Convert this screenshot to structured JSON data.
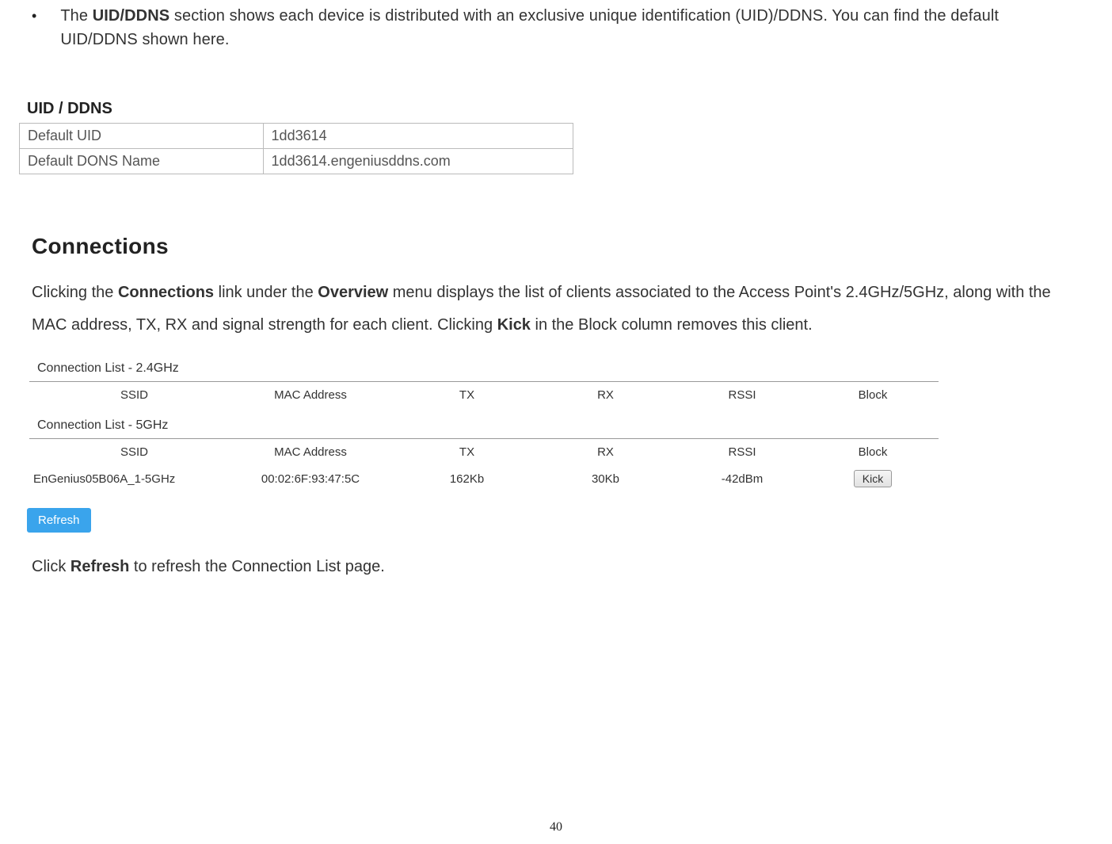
{
  "bullet": {
    "before": "The ",
    "bold": "UID/DDNS",
    "after": " section shows each device is distributed with an exclusive unique identification (UID)/DDNS. You can find the default UID/DDNS shown here."
  },
  "uid": {
    "title": "UID / DDNS",
    "rows": [
      {
        "label": "Default UID",
        "value": "1dd3614"
      },
      {
        "label": "Default DONS Name",
        "value": "1dd3614.engeniusddns.com"
      }
    ]
  },
  "heading": "Connections",
  "body": {
    "t1": "Clicking the ",
    "b1": "Connections",
    "t2": " link under the ",
    "b2": "Overview",
    "t3": " menu displays the list of clients associated to the Access Point's 2.4GHz/5GHz, along with the MAC address, TX, RX and signal strength for each client. Clicking ",
    "b3": "Kick",
    "t4": " in the Block column removes this client."
  },
  "conn": {
    "title24": "Connection List - 2.4GHz",
    "title5": "Connection List - 5GHz",
    "cols": {
      "ssid": "SSID",
      "mac": "MAC Address",
      "tx": "TX",
      "rx": "RX",
      "rssi": "RSSI",
      "block": "Block"
    },
    "row5": {
      "ssid": "EnGenius05B06A_1-5GHz",
      "mac": "00:02:6F:93:47:5C",
      "tx": "162Kb",
      "rx": "30Kb",
      "rssi": "-42dBm",
      "kick": "Kick"
    },
    "refresh": "Refresh"
  },
  "footer": {
    "t1": "Click ",
    "b1": "Refresh",
    "t2": " to refresh the Connection List page."
  },
  "page_number": "40"
}
